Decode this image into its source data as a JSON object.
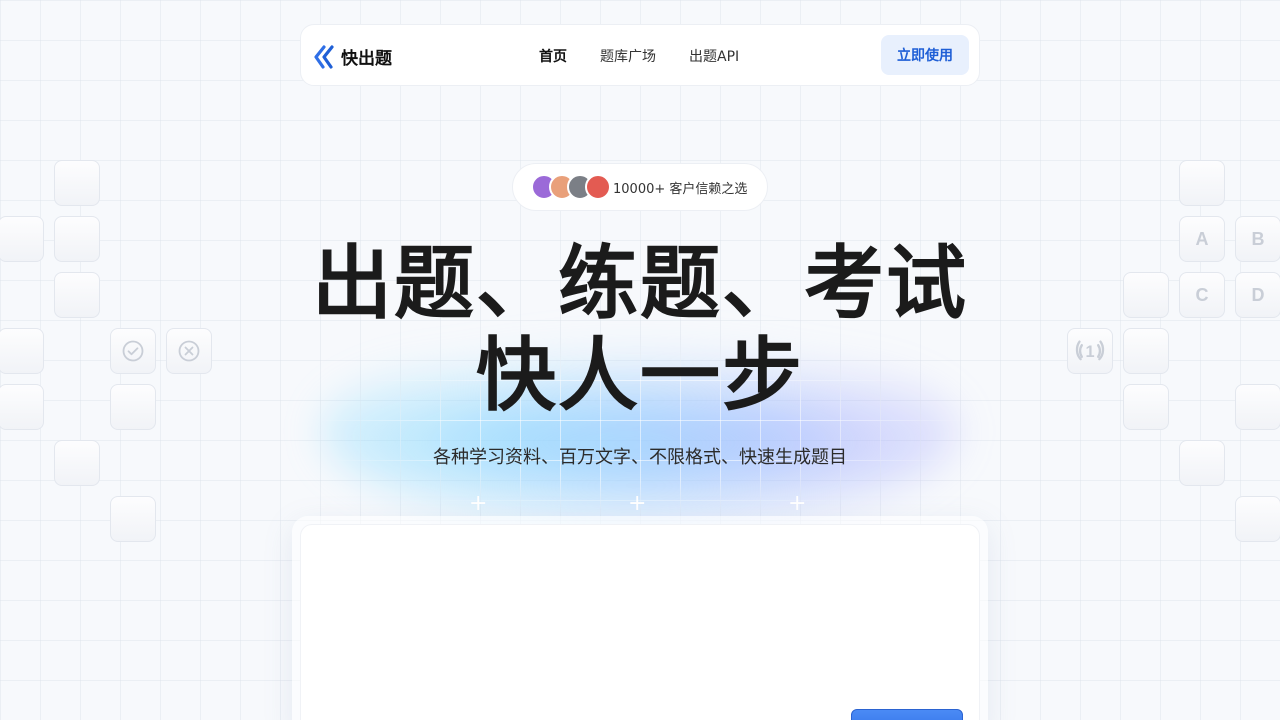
{
  "nav": {
    "brand": "快出题",
    "links": [
      {
        "label": "首页",
        "active": true
      },
      {
        "label": "题库广场",
        "active": false
      },
      {
        "label": "出题API",
        "active": false
      }
    ],
    "cta_label": "立即使用"
  },
  "badge": {
    "text": "10000+ 客户信赖之选",
    "avatar_colors": [
      "#9b6ad8",
      "#e9a07a",
      "#7b7f86",
      "#e35b52"
    ]
  },
  "hero": {
    "title_line1": "出题、练题、考试",
    "title_line2": "快人一步",
    "subtitle": "各种学习资料、百万文字、不限格式、快速生成题目"
  },
  "decor_tiles": {
    "left": [
      "",
      "",
      "",
      "",
      "",
      "",
      "",
      "",
      "",
      "",
      ""
    ],
    "right_letters": [
      "A",
      "B",
      "C",
      "D"
    ],
    "rank_badge": "1"
  },
  "colors": {
    "brand_blue": "#1f5fd6",
    "cta_bg": "#e8f0fd",
    "title": "#1b1b1b"
  }
}
